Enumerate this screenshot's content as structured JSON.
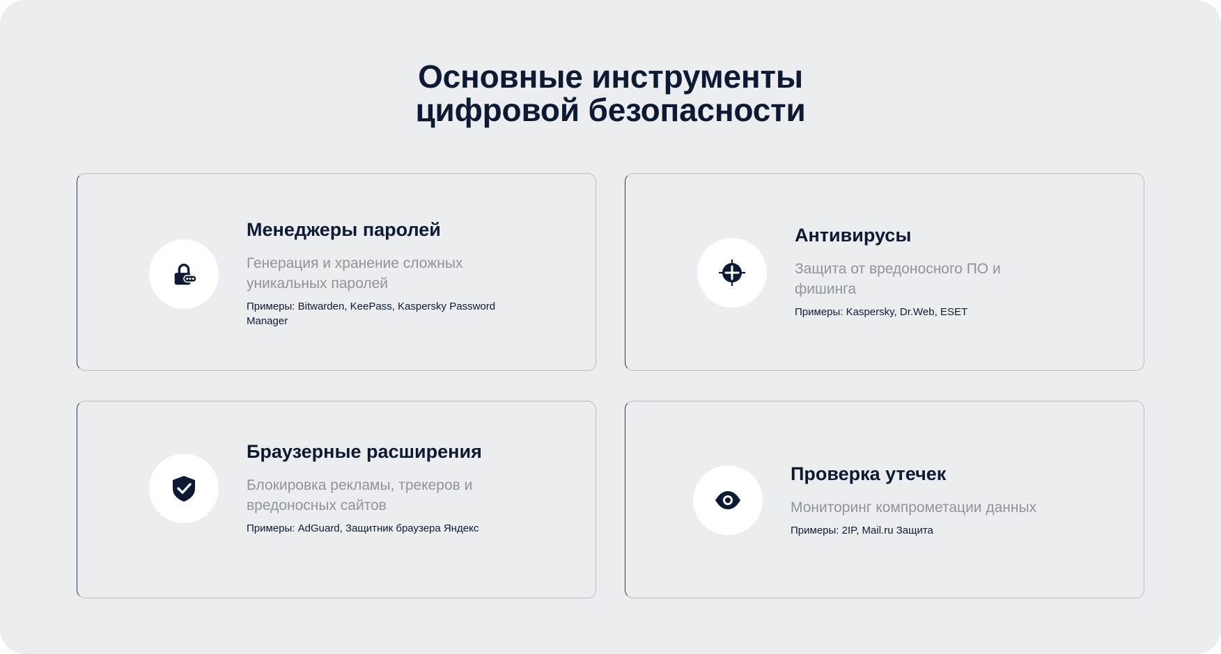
{
  "page": {
    "title_line1": "Основные инструменты",
    "title_line2": "цифровой безопасности"
  },
  "colors": {
    "background": "#ebedef",
    "ink": "#0c1b33",
    "muted_text": "#8e949c",
    "icon_bg": "#ffffff"
  },
  "cards": [
    {
      "icon": "lock-icon",
      "title": "Менеджеры паролей",
      "description": "Генерация и хранение сложных уникальных паролей",
      "examples": "Примеры: Bitwarden, KeePass, Kaspersky Password Manager"
    },
    {
      "icon": "crosshair-plus-icon",
      "title": "Антивирусы",
      "description": "Защита от вредоносного ПО и фишинга",
      "examples": "Примеры: Kaspersky, Dr.Web, ESET"
    },
    {
      "icon": "shield-check-icon",
      "title": "Браузерные расширения",
      "description": "Блокировка рекламы, трекеров и вредоносных сайтов",
      "examples": "Примеры: AdGuard, Защитник браузера Яндекс"
    },
    {
      "icon": "eye-icon",
      "title": "Проверка утечек",
      "description": "Мониторинг компрометации данных",
      "examples": "Примеры:  2IP, Mail.ru Защита"
    }
  ]
}
